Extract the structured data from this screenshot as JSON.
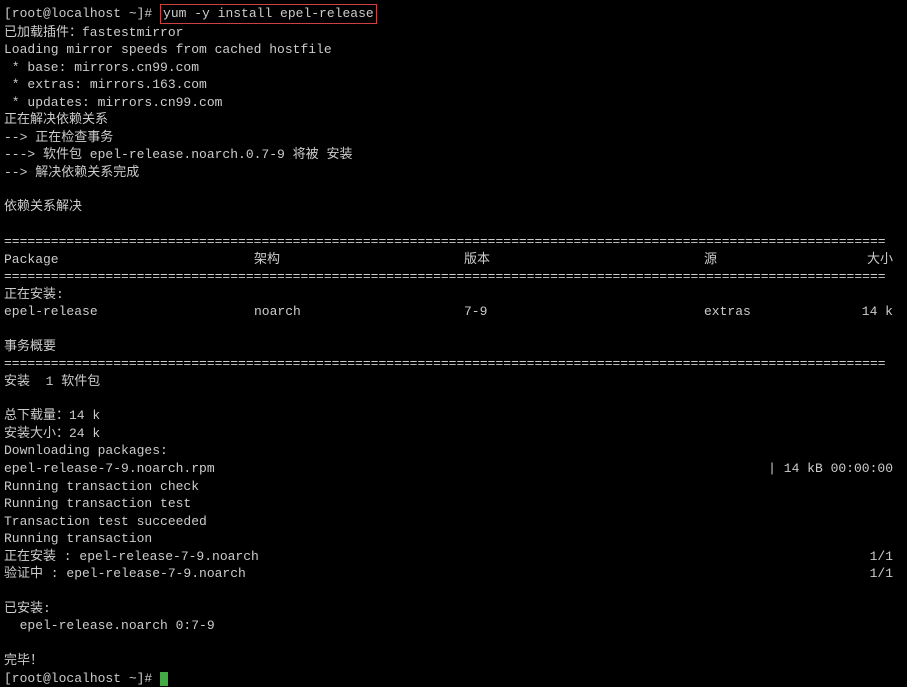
{
  "prompt": {
    "user_host": "[root@localhost ~]# ",
    "command": "yum -y install epel-release"
  },
  "preamble": [
    "已加载插件：fastestmirror",
    "Loading mirror speeds from cached hostfile",
    " * base: mirrors.cn99.com",
    " * extras: mirrors.163.com",
    " * updates: mirrors.cn99.com",
    "正在解决依赖关系",
    "--> 正在检查事务",
    "---> 软件包 epel-release.noarch.0.7-9 将被 安装",
    "--> 解决依赖关系完成"
  ],
  "deps_resolved": "依赖关系解决",
  "headers": {
    "package": " Package",
    "arch": "架构",
    "version": "版本",
    "repo": "源",
    "size": "大小"
  },
  "installing_label": "正在安装:",
  "package_row": {
    "name": " epel-release",
    "arch": "noarch",
    "version": "7-9",
    "repo": "extras",
    "size": "14 k"
  },
  "summary_label": "事务概要",
  "install_count": "安装  1 软件包",
  "totals": [
    "总下载量：14 k",
    "安装大小：24 k",
    "Downloading packages:"
  ],
  "download_row": {
    "name": "epel-release-7-9.noarch.rpm",
    "progress": "|  14 kB  00:00:00     "
  },
  "transaction": [
    "Running transaction check",
    "Running transaction test",
    "Transaction test succeeded",
    "Running transaction"
  ],
  "trans_rows": [
    {
      "left": "  正在安装    : epel-release-7-9.noarch",
      "right": "1/1 "
    },
    {
      "left": "  验证中      : epel-release-7-9.noarch",
      "right": "1/1 "
    }
  ],
  "installed_label": "已安装:",
  "installed_pkg": "  epel-release.noarch 0:7-9",
  "done": "完毕！",
  "final_prompt": "[root@localhost ~]# ",
  "double_line": "================================================================================================================="
}
